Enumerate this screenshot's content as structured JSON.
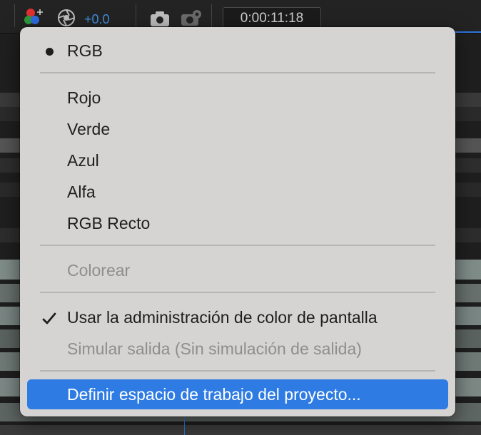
{
  "toolbar": {
    "exposure_value": "+0.0",
    "timecode": "0:00:11:18",
    "icons": [
      "rgb-channels-icon",
      "aperture-icon",
      "camera-icon",
      "show-snapshot-icon"
    ]
  },
  "menu": {
    "items": [
      {
        "label": "RGB",
        "mark": "bullet",
        "enabled": true
      },
      {
        "label": "Rojo",
        "enabled": true
      },
      {
        "label": "Verde",
        "enabled": true
      },
      {
        "label": "Azul",
        "enabled": true
      },
      {
        "label": "Alfa",
        "enabled": true
      },
      {
        "label": "RGB Recto",
        "enabled": true
      },
      {
        "label": "Colorear",
        "enabled": false
      },
      {
        "label": "Usar la administración de color de pantalla",
        "mark": "check",
        "enabled": true
      },
      {
        "label": "Simular salida (Sin simulación de salida)",
        "enabled": false
      },
      {
        "label": "Definir espacio de trabajo del proyecto...",
        "enabled": true,
        "highlighted": true
      }
    ]
  },
  "colors": {
    "menu_bg": "#d6d4d3",
    "highlight": "#2d7be3",
    "accent_blue": "#3f8fe0"
  }
}
